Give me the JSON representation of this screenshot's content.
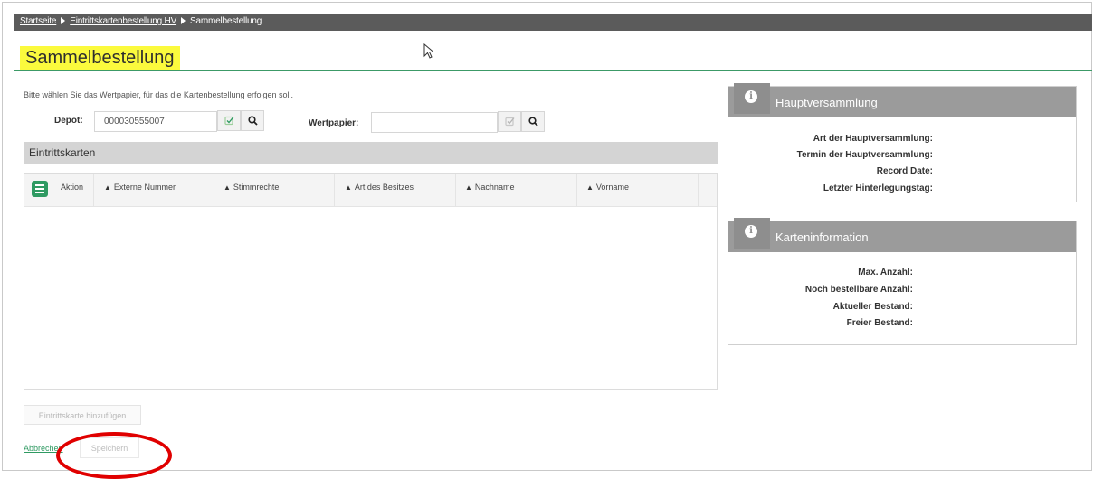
{
  "breadcrumb": {
    "home": "Startseite",
    "parent": "Eintrittskartenbestellung HV",
    "current": "Sammelbestellung"
  },
  "page": {
    "title": "Sammelbestellung",
    "intro": "Bitte wählen Sie das Wertpapier, für das die Kartenbestellung erfolgen soll."
  },
  "form": {
    "depot_label": "Depot:",
    "depot_value": "000030555007",
    "wertpapier_label": "Wertpapier:",
    "wertpapier_value": ""
  },
  "eintrittskarten": {
    "section_title": "Eintrittskarten",
    "columns": [
      "Aktion",
      "Externe Nummer",
      "Stimmrechte",
      "Art des Besitzes",
      "Nachname",
      "Vorname"
    ],
    "rows": []
  },
  "actions": {
    "add_card": "Eintrittskarte hinzufügen",
    "cancel": "Abbrechen",
    "save": "Speichern"
  },
  "hv_panel": {
    "title": "Hauptversammlung",
    "fields": [
      "Art der Hauptversammlung:",
      "Termin der Hauptversammlung:",
      "Record Date:",
      "Letzter Hinterlegungstag:"
    ]
  },
  "card_panel": {
    "title": "Karteninformation",
    "fields": [
      "Max. Anzahl:",
      "Noch bestellbare Anzahl:",
      "Aktueller Bestand:",
      "Freier Bestand:"
    ]
  },
  "colors": {
    "accent": "#2f9a62",
    "highlight": "#fbfa3d",
    "annotation": "#e00000",
    "topbar": "#5b5b5b",
    "panel_header": "#9b9b9b"
  },
  "icons": [
    "check-square-icon",
    "search-icon",
    "info-icon",
    "menu-icon",
    "sort-icon",
    "mouse-pointer-icon"
  ]
}
